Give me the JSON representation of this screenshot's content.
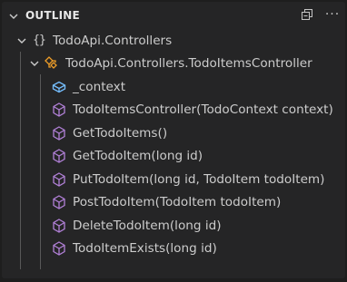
{
  "outline": {
    "title": "OUTLINE",
    "actions": {
      "collapse_all": "collapse-all-icon",
      "more": "···"
    },
    "namespace": {
      "label": "TodoApi.Controllers",
      "icon": "namespace-braces-icon"
    },
    "class": {
      "label": "TodoApi.Controllers.TodoItemsController",
      "icon": "class-icon",
      "color": "#ee9d28"
    },
    "members": [
      {
        "label": "_context",
        "icon": "field-icon",
        "color": "#75beff"
      },
      {
        "label": "TodoItemsController(TodoContext context)",
        "icon": "method-icon",
        "color": "#b180d7"
      },
      {
        "label": "GetTodoItems()",
        "icon": "method-icon",
        "color": "#b180d7"
      },
      {
        "label": "GetTodoItem(long id)",
        "icon": "method-icon",
        "color": "#b180d7"
      },
      {
        "label": "PutTodoItem(long id, TodoItem todoItem)",
        "icon": "method-icon",
        "color": "#b180d7"
      },
      {
        "label": "PostTodoItem(TodoItem todoItem)",
        "icon": "method-icon",
        "color": "#b180d7"
      },
      {
        "label": "DeleteTodoItem(long id)",
        "icon": "method-icon",
        "color": "#b180d7"
      },
      {
        "label": "TodoItemExists(long id)",
        "icon": "method-icon",
        "color": "#b180d7"
      }
    ]
  }
}
